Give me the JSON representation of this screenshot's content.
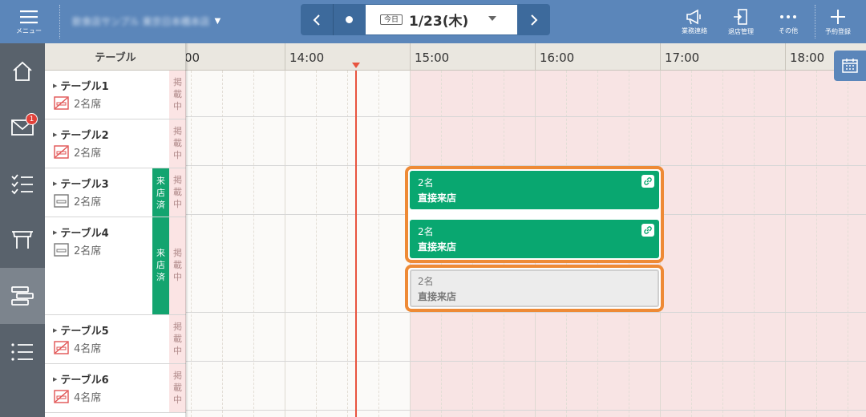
{
  "header": {
    "menu_label": "メニュー",
    "store_name": "飲食店サンプル 東京日本橋本店",
    "date_nav": {
      "today_label": "今日",
      "date": "1/23(木)"
    },
    "actions": [
      {
        "label": "業務連絡",
        "icon": "megaphone-icon"
      },
      {
        "label": "退店管理",
        "icon": "exit-door-icon"
      },
      {
        "label": "その他",
        "icon": "more-dots-icon"
      },
      {
        "label": "予約登録",
        "icon": "plus-icon"
      }
    ]
  },
  "sidebar": {
    "items": [
      {
        "name": "home",
        "icon": "home-icon"
      },
      {
        "name": "messages",
        "icon": "mail-icon",
        "badge": "1"
      },
      {
        "name": "tasks",
        "icon": "checklist-icon"
      },
      {
        "name": "tables",
        "icon": "table-icon"
      },
      {
        "name": "timeline",
        "icon": "timeline-icon",
        "active": true
      },
      {
        "name": "list",
        "icon": "list-icon"
      }
    ]
  },
  "table_column": {
    "header": "テーブル",
    "rows": [
      {
        "name": "テーブル1",
        "seats": "2名席",
        "status": [
          "掲",
          "載",
          "中"
        ],
        "visited": null
      },
      {
        "name": "テーブル2",
        "seats": "2名席",
        "status": [
          "掲",
          "載",
          "中"
        ],
        "visited": null
      },
      {
        "name": "テーブル3",
        "seats": "2名席",
        "status": [
          "掲",
          "載",
          "中"
        ],
        "visited": [
          "来",
          "店",
          "済"
        ]
      },
      {
        "name": "テーブル4",
        "seats": "2名席",
        "status": [
          "掲",
          "載",
          "中"
        ],
        "visited": [
          "来",
          "店",
          "済"
        ]
      },
      {
        "name": "テーブル5",
        "seats": "4名席",
        "status": [
          "掲",
          "載",
          "中"
        ],
        "visited": null
      },
      {
        "name": "テーブル6",
        "seats": "4名席",
        "status": [
          "掲",
          "載",
          "中"
        ],
        "visited": null
      }
    ]
  },
  "timeline": {
    "hours": [
      "00",
      "14:00",
      "15:00",
      "16:00",
      "17:00",
      "18:00"
    ],
    "current_time": "14:30",
    "closed_from": "14:45"
  },
  "reservations": [
    {
      "count": "2名",
      "type": "直接来店",
      "status": "visited",
      "linked": true
    },
    {
      "count": "2名",
      "type": "直接来店",
      "status": "visited",
      "linked": true
    },
    {
      "count": "2名",
      "type": "直接来店",
      "status": "pending",
      "linked": false
    }
  ],
  "colors": {
    "header_bg": "#5b86ba",
    "sidebar_bg": "#59626c",
    "green": "#09a770",
    "highlight": "#ee8a36",
    "now_line": "#e8543f",
    "closed_bg": "#f8e4e4"
  }
}
